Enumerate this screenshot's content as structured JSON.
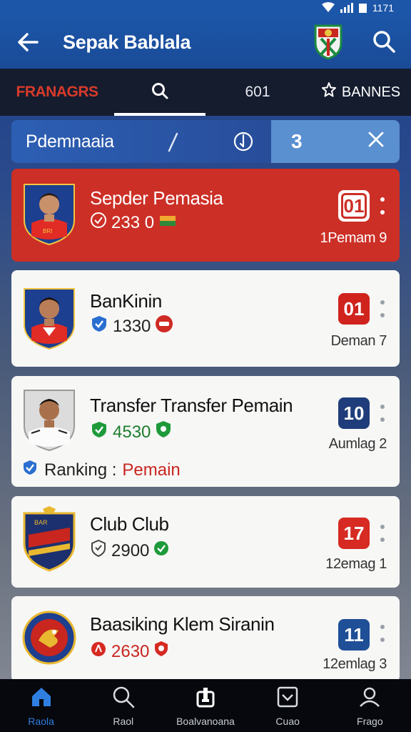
{
  "status": {
    "time": "1171"
  },
  "header": {
    "title": "Sepak Bablala",
    "back_icon": "arrow-left-icon",
    "crest_icon": "club-crest-icon",
    "search_icon": "search-icon"
  },
  "tabs": [
    {
      "label": "FRANAGRS"
    },
    {
      "label": "",
      "icon": "search-icon"
    },
    {
      "label": "601"
    },
    {
      "label": "BANNES",
      "icon": "gear-star-icon"
    }
  ],
  "search": {
    "value": "Pdemnaaia",
    "count": "3"
  },
  "cards": [
    {
      "name": "Sepder Pemasia",
      "stat": "233 0",
      "rank": "01",
      "sub": "1Pemam 9",
      "rank_color": "#cc2f26"
    },
    {
      "name": "BanKinin",
      "stat": "1330",
      "rank": "01",
      "sub": "Deman 7",
      "rank_color": "#d0231d"
    },
    {
      "name": "Transfer Transfer Pemain",
      "stat": "4530",
      "rank": "10",
      "sub": "Aumlag 2",
      "rank_color": "#1f3d7a",
      "extra_label": "Ranking :",
      "extra_value": "Pemain"
    },
    {
      "name": "Club Club",
      "stat": "2900",
      "rank": "17",
      "sub": "12emag 1",
      "rank_color": "#d62a22"
    },
    {
      "name": "Baasiking Klem Siranin",
      "stat": "2630",
      "rank": "11",
      "sub": "12emlag 3",
      "rank_color": "#1e4f97"
    }
  ],
  "nav": [
    {
      "label": "Raola",
      "icon": "home-icon"
    },
    {
      "label": "Raol",
      "icon": "search-icon"
    },
    {
      "label": "Boalvanoana",
      "icon": "trophy-icon"
    },
    {
      "label": "Cuao",
      "icon": "inbox-icon"
    },
    {
      "label": "Frago",
      "icon": "profile-icon"
    }
  ],
  "colors": {
    "primary": "#1c56a8",
    "accent_red": "#cc2f26",
    "nav_active": "#2f7fe0"
  }
}
